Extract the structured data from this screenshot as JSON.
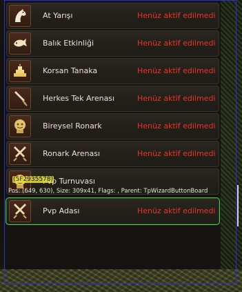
{
  "events": [
    {
      "label": "At Yarışı",
      "status": "Henüz aktif edilmedi",
      "icon": "horse-head-icon"
    },
    {
      "label": "Balık Etkinliği",
      "status": "Henüz aktif edilmedi",
      "icon": "fish-icon"
    },
    {
      "label": "Korsan Tanaka",
      "status": "Henüz aktif edilmedi",
      "icon": "gold-bars-icon"
    },
    {
      "label": "Herkes Tek Arenası",
      "status": "Henüz aktif edilmedi",
      "icon": "sword-icon"
    },
    {
      "label": "Bireysel Ronark",
      "status": "Henüz aktif edilmedi",
      "icon": "golden-idol-icon"
    },
    {
      "label": "Ronark Arenası",
      "status": "Henüz aktif edilmedi",
      "icon": "crossed-swords-icon"
    },
    {
      "label": "Pvp Turnuvası",
      "status": "",
      "icon": "golden-idol-icon"
    },
    {
      "label": "Pvp Adası",
      "status": "Henüz aktif edilmedi",
      "icon": "crossed-swords-icon"
    }
  ],
  "debug": {
    "id_tag": "(5F2935578)",
    "info": "Pos: (649, 630), Size: 309x41, Flags: , Parent: TpWizardButtonBoard"
  },
  "colors": {
    "status_red": "#e8332c",
    "selected_outline": "#43d34a",
    "debug_frame": "#2b2fd0"
  }
}
